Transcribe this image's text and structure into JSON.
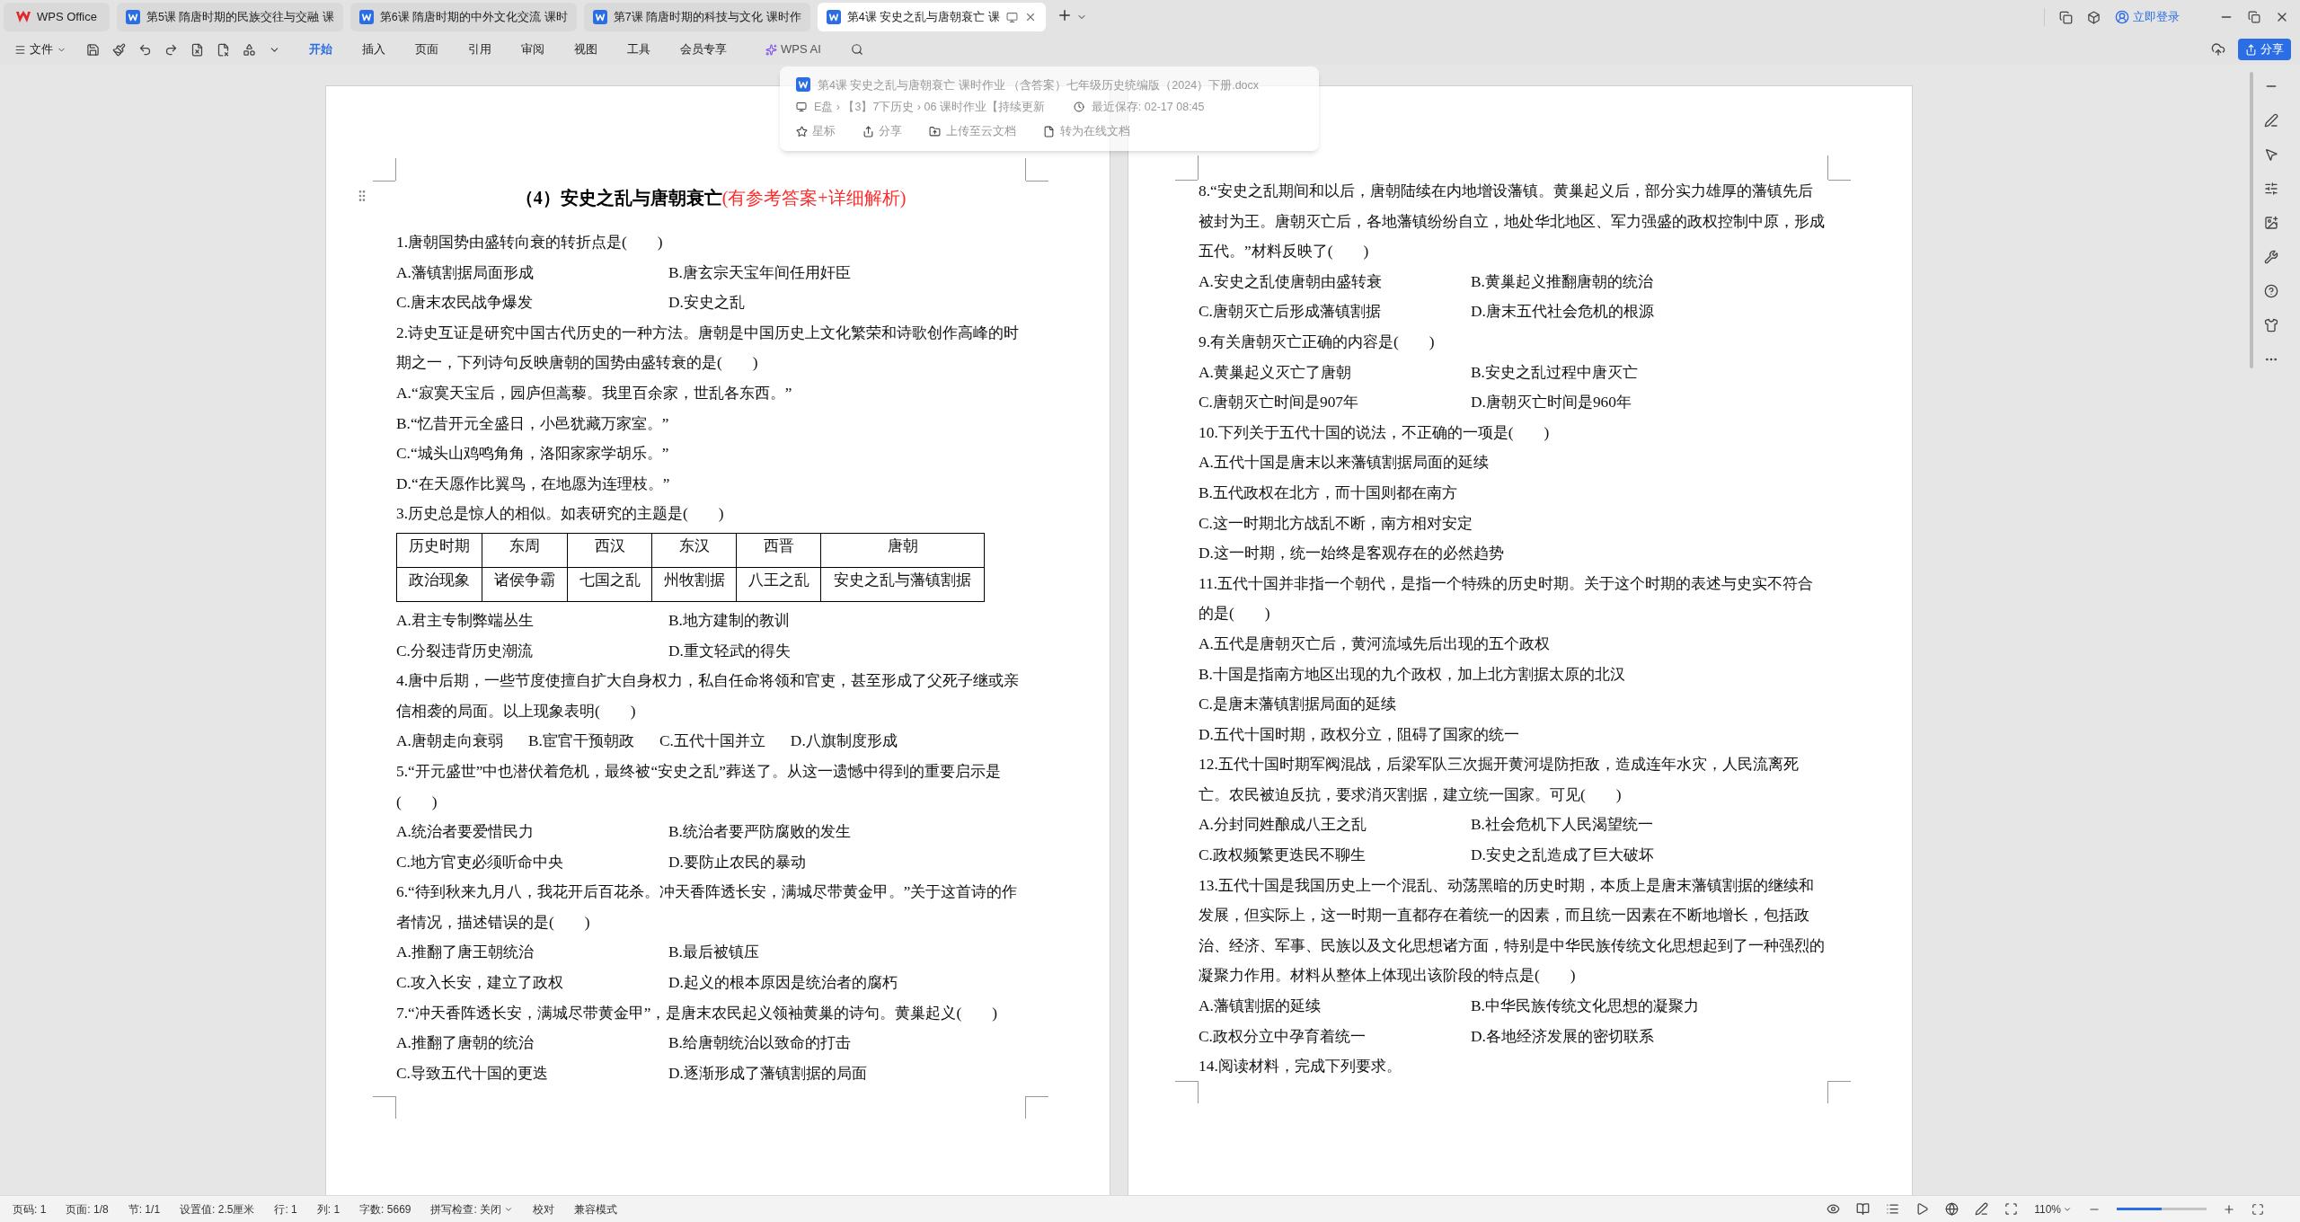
{
  "tab_bar": {
    "home": "WPS Office",
    "tabs": [
      {
        "label": "第5课 隋唐时期的民族交往与交融 课",
        "selected": false
      },
      {
        "label": "第6课 隋唐时期的中外文化交流 课时",
        "selected": false
      },
      {
        "label": "第7课 隋唐时期的科技与文化 课时作",
        "selected": false
      },
      {
        "label": "第4课 安史之乱与唐朝衰亡 课",
        "selected": true
      }
    ]
  },
  "title_bar": {
    "login": "立即登录"
  },
  "toolbar": {
    "file_menu": "文件",
    "ribbon_tabs": [
      {
        "label": "开始",
        "selected": true
      },
      {
        "label": "插入",
        "selected": false
      },
      {
        "label": "页面",
        "selected": false
      },
      {
        "label": "引用",
        "selected": false
      },
      {
        "label": "审阅",
        "selected": false
      },
      {
        "label": "视图",
        "selected": false
      },
      {
        "label": "工具",
        "selected": false
      },
      {
        "label": "会员专享",
        "selected": false
      }
    ],
    "ai": "WPS AI",
    "share": "分享"
  },
  "hover_card": {
    "file_name": "第4课 安史之乱与唐朝衰亡 课时作业 （含答案）七年级历史统编版（2024）下册.docx",
    "path": "E盘 › 【3】7下历史 › 06 课时作业【持续更新",
    "saved": "最近保存: 02-17 08:45",
    "actions": [
      "星标",
      "分享"
    ],
    "menu": [
      "上传至云文档",
      "转为在线文档"
    ]
  },
  "pages": [
    {
      "blocks": [
        {
          "kind": "title",
          "text": "（4）安史之乱与唐朝衰亡",
          "note": "(有参考答案+详细解析)"
        },
        {
          "kind": "question",
          "text": "1.唐朝国势由盛转向衰的转折点是(　　)"
        },
        {
          "kind": "options",
          "items": [
            "A.藩镇割据局面形成",
            "B.唐玄宗天宝年间任用奸臣"
          ]
        },
        {
          "kind": "options",
          "items": [
            "C.唐末农民战争爆发",
            "D.安史之乱"
          ]
        },
        {
          "kind": "question",
          "text": "2.诗史互证是研究中国古代历史的一种方法。唐朝是中国历史上文化繁荣和诗歌创作高峰的时期之一，下列诗句反映唐朝的国势由盛转衰的是(　　)"
        },
        {
          "kind": "options",
          "items": [
            "A.“寂寞天宝后，园庐但蒿藜。我里百余家，世乱各东西。”"
          ]
        },
        {
          "kind": "options",
          "items": [
            "B.“忆昔开元全盛日，小邑犹藏万家室。”"
          ]
        },
        {
          "kind": "options",
          "items": [
            "C.“城头山鸡鸣角角，洛阳家家学胡乐。”"
          ]
        },
        {
          "kind": "options",
          "items": [
            "D.“在天愿作比翼鸟，在地愿为连理枝。”"
          ]
        },
        {
          "kind": "question",
          "text": "3.历史总是惊人的相似。如表研究的主题是(　　)"
        },
        {
          "kind": "table",
          "rows": [
            [
              "历史时期",
              "东周",
              "西汉",
              "东汉",
              "西晋",
              "唐朝"
            ],
            [
              "政治现象",
              "诸侯争霸",
              "七国之乱",
              "州牧割据",
              "八王之乱",
              "安史之乱与藩镇割据"
            ]
          ]
        },
        {
          "kind": "options",
          "items": [
            "A.君主专制弊端丛生",
            "B.地方建制的教训"
          ]
        },
        {
          "kind": "options",
          "items": [
            "C.分裂违背历史潮流",
            "D.重文轻武的得失"
          ]
        },
        {
          "kind": "question",
          "text": "4.唐中后期，一些节度使擅自扩大自身权力，私自任命将领和官吏，甚至形成了父死子继或亲信相袭的局面。以上现象表明(　　)"
        },
        {
          "kind": "options",
          "items": [
            "A.唐朝走向衰弱",
            "B.宦官干预朝政",
            "C.五代十国并立",
            "D.八旗制度形成"
          ]
        },
        {
          "kind": "question",
          "text": "5.“开元盛世”中也潜伏着危机，最终被“安史之乱”葬送了。从这一遗憾中得到的重要启示是(　　)"
        },
        {
          "kind": "options",
          "items": [
            "A.统治者要爱惜民力",
            "B.统治者要严防腐败的发生"
          ]
        },
        {
          "kind": "options",
          "items": [
            "C.地方官吏必须听命中央",
            "D.要防止农民的暴动"
          ]
        },
        {
          "kind": "question",
          "text": "6.“待到秋来九月八，我花开后百花杀。冲天香阵透长安，满城尽带黄金甲。”关于这首诗的作者情况，描述错误的是(　　)"
        },
        {
          "kind": "options",
          "items": [
            "A.推翻了唐王朝统治",
            "B.最后被镇压"
          ]
        },
        {
          "kind": "options",
          "items": [
            "C.攻入长安，建立了政权",
            "D.起义的根本原因是统治者的腐朽"
          ]
        },
        {
          "kind": "question",
          "text": "7.“冲天香阵透长安，满城尽带黄金甲”，是唐末农民起义领袖黄巢的诗句。黄巢起义(　　)"
        },
        {
          "kind": "options",
          "items": [
            "A.推翻了唐朝的统治",
            "B.给唐朝统治以致命的打击"
          ]
        },
        {
          "kind": "options",
          "items": [
            "C.导致五代十国的更迭",
            "D.逐渐形成了藩镇割据的局面"
          ]
        }
      ]
    },
    {
      "blocks": [
        {
          "kind": "question",
          "text": "8.“安史之乱期间和以后，唐朝陆续在内地增设藩镇。黄巢起义后，部分实力雄厚的藩镇先后被封为王。唐朝灭亡后，各地藩镇纷纷自立，地处华北地区、军力强盛的政权控制中原，形成五代。”材料反映了(　　)"
        },
        {
          "kind": "options",
          "items": [
            "A.安史之乱使唐朝由盛转衰",
            "B.黄巢起义推翻唐朝的统治"
          ]
        },
        {
          "kind": "options",
          "items": [
            "C.唐朝灭亡后形成藩镇割据",
            "D.唐末五代社会危机的根源"
          ]
        },
        {
          "kind": "question",
          "text": "9.有关唐朝灭亡正确的内容是(　　)"
        },
        {
          "kind": "options",
          "items": [
            "A.黄巢起义灭亡了唐朝",
            "B.安史之乱过程中唐灭亡"
          ]
        },
        {
          "kind": "options",
          "items": [
            "C.唐朝灭亡时间是907年",
            "D.唐朝灭亡时间是960年"
          ]
        },
        {
          "kind": "question",
          "text": "10.下列关于五代十国的说法，不正确的一项是(　　)"
        },
        {
          "kind": "options",
          "items": [
            "A.五代十国是唐末以来藩镇割据局面的延续"
          ]
        },
        {
          "kind": "options",
          "items": [
            "B.五代政权在北方，而十国则都在南方"
          ]
        },
        {
          "kind": "options",
          "items": [
            "C.这一时期北方战乱不断，南方相对安定"
          ]
        },
        {
          "kind": "options",
          "items": [
            "D.这一时期，统一始终是客观存在的必然趋势"
          ]
        },
        {
          "kind": "question",
          "text": "11.五代十国并非指一个朝代，是指一个特殊的历史时期。关于这个时期的表述与史实不符合的是(　　)"
        },
        {
          "kind": "options",
          "items": [
            "A.五代是唐朝灭亡后，黄河流域先后出现的五个政权"
          ]
        },
        {
          "kind": "options",
          "items": [
            "B.十国是指南方地区出现的九个政权，加上北方割据太原的北汉"
          ]
        },
        {
          "kind": "options",
          "items": [
            "C.是唐末藩镇割据局面的延续"
          ]
        },
        {
          "kind": "options",
          "items": [
            "D.五代十国时期，政权分立，阻碍了国家的统一"
          ]
        },
        {
          "kind": "question",
          "text": "12.五代十国时期军阀混战，后梁军队三次掘开黄河堤防拒敌，造成连年水灾，人民流离死亡。农民被迫反抗，要求消灭割据，建立统一国家。可见(　　)"
        },
        {
          "kind": "options",
          "items": [
            "A.分封同姓酿成八王之乱",
            "B.社会危机下人民渴望统一"
          ]
        },
        {
          "kind": "options",
          "items": [
            "C.政权频繁更迭民不聊生",
            "D.安史之乱造成了巨大破坏"
          ]
        },
        {
          "kind": "question",
          "text": "13.五代十国是我国历史上一个混乱、动荡黑暗的历史时期，本质上是唐末藩镇割据的继续和发展，但实际上，这一时期一直都存在着统一的因素，而且统一因素在不断地增长，包括政治、经济、军事、民族以及文化思想诸方面，特别是中华民族传统文化思想起到了一种强烈的凝聚力作用。材料从整体上体现出该阶段的特点是(　　)"
        },
        {
          "kind": "options",
          "items": [
            "A.藩镇割据的延续",
            "B.中华民族传统文化思想的凝聚力"
          ]
        },
        {
          "kind": "options",
          "items": [
            "C.政权分立中孕育着统一",
            "D.各地经济发展的密切联系"
          ]
        },
        {
          "kind": "question",
          "text": "14.阅读材料，完成下列要求。"
        }
      ]
    }
  ],
  "status_bar": {
    "items": [
      {
        "text": "页码: 1",
        "dropdown": false
      },
      {
        "text": "页面: 1/8",
        "dropdown": false
      },
      {
        "text": "节: 1/1",
        "dropdown": false
      },
      {
        "text": "设置值: 2.5厘米",
        "dropdown": false
      },
      {
        "text": "行: 1",
        "dropdown": false
      },
      {
        "text": "列: 1",
        "dropdown": false
      },
      {
        "text": "字数: 5669",
        "dropdown": false
      },
      {
        "text": "拼写检查: 关闭",
        "dropdown": true
      },
      {
        "text": "校对",
        "dropdown": false
      },
      {
        "text": "兼容模式",
        "dropdown": false
      }
    ],
    "zoom": "110%",
    "zoom_slider": {
      "level": 0.5
    }
  }
}
